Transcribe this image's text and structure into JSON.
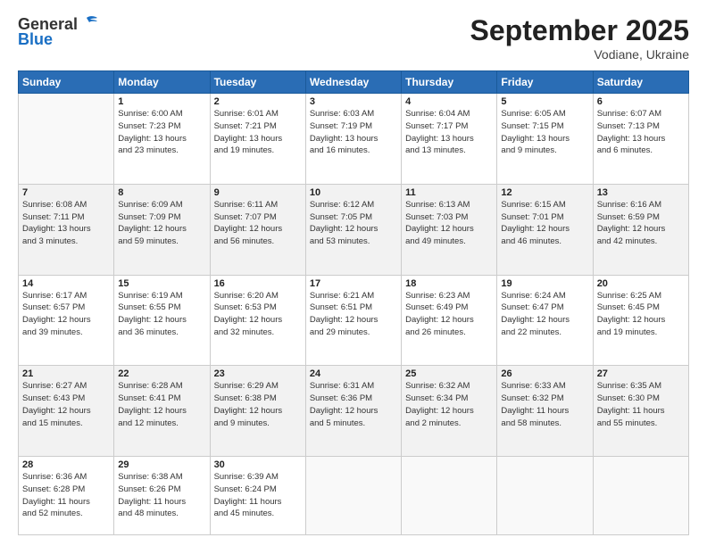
{
  "header": {
    "logo_line1": "General",
    "logo_line2": "Blue",
    "month": "September 2025",
    "location": "Vodiane, Ukraine"
  },
  "days_of_week": [
    "Sunday",
    "Monday",
    "Tuesday",
    "Wednesday",
    "Thursday",
    "Friday",
    "Saturday"
  ],
  "weeks": [
    [
      {
        "day": "",
        "info": ""
      },
      {
        "day": "1",
        "info": "Sunrise: 6:00 AM\nSunset: 7:23 PM\nDaylight: 13 hours\nand 23 minutes."
      },
      {
        "day": "2",
        "info": "Sunrise: 6:01 AM\nSunset: 7:21 PM\nDaylight: 13 hours\nand 19 minutes."
      },
      {
        "day": "3",
        "info": "Sunrise: 6:03 AM\nSunset: 7:19 PM\nDaylight: 13 hours\nand 16 minutes."
      },
      {
        "day": "4",
        "info": "Sunrise: 6:04 AM\nSunset: 7:17 PM\nDaylight: 13 hours\nand 13 minutes."
      },
      {
        "day": "5",
        "info": "Sunrise: 6:05 AM\nSunset: 7:15 PM\nDaylight: 13 hours\nand 9 minutes."
      },
      {
        "day": "6",
        "info": "Sunrise: 6:07 AM\nSunset: 7:13 PM\nDaylight: 13 hours\nand 6 minutes."
      }
    ],
    [
      {
        "day": "7",
        "info": "Sunrise: 6:08 AM\nSunset: 7:11 PM\nDaylight: 13 hours\nand 3 minutes."
      },
      {
        "day": "8",
        "info": "Sunrise: 6:09 AM\nSunset: 7:09 PM\nDaylight: 12 hours\nand 59 minutes."
      },
      {
        "day": "9",
        "info": "Sunrise: 6:11 AM\nSunset: 7:07 PM\nDaylight: 12 hours\nand 56 minutes."
      },
      {
        "day": "10",
        "info": "Sunrise: 6:12 AM\nSunset: 7:05 PM\nDaylight: 12 hours\nand 53 minutes."
      },
      {
        "day": "11",
        "info": "Sunrise: 6:13 AM\nSunset: 7:03 PM\nDaylight: 12 hours\nand 49 minutes."
      },
      {
        "day": "12",
        "info": "Sunrise: 6:15 AM\nSunset: 7:01 PM\nDaylight: 12 hours\nand 46 minutes."
      },
      {
        "day": "13",
        "info": "Sunrise: 6:16 AM\nSunset: 6:59 PM\nDaylight: 12 hours\nand 42 minutes."
      }
    ],
    [
      {
        "day": "14",
        "info": "Sunrise: 6:17 AM\nSunset: 6:57 PM\nDaylight: 12 hours\nand 39 minutes."
      },
      {
        "day": "15",
        "info": "Sunrise: 6:19 AM\nSunset: 6:55 PM\nDaylight: 12 hours\nand 36 minutes."
      },
      {
        "day": "16",
        "info": "Sunrise: 6:20 AM\nSunset: 6:53 PM\nDaylight: 12 hours\nand 32 minutes."
      },
      {
        "day": "17",
        "info": "Sunrise: 6:21 AM\nSunset: 6:51 PM\nDaylight: 12 hours\nand 29 minutes."
      },
      {
        "day": "18",
        "info": "Sunrise: 6:23 AM\nSunset: 6:49 PM\nDaylight: 12 hours\nand 26 minutes."
      },
      {
        "day": "19",
        "info": "Sunrise: 6:24 AM\nSunset: 6:47 PM\nDaylight: 12 hours\nand 22 minutes."
      },
      {
        "day": "20",
        "info": "Sunrise: 6:25 AM\nSunset: 6:45 PM\nDaylight: 12 hours\nand 19 minutes."
      }
    ],
    [
      {
        "day": "21",
        "info": "Sunrise: 6:27 AM\nSunset: 6:43 PM\nDaylight: 12 hours\nand 15 minutes."
      },
      {
        "day": "22",
        "info": "Sunrise: 6:28 AM\nSunset: 6:41 PM\nDaylight: 12 hours\nand 12 minutes."
      },
      {
        "day": "23",
        "info": "Sunrise: 6:29 AM\nSunset: 6:38 PM\nDaylight: 12 hours\nand 9 minutes."
      },
      {
        "day": "24",
        "info": "Sunrise: 6:31 AM\nSunset: 6:36 PM\nDaylight: 12 hours\nand 5 minutes."
      },
      {
        "day": "25",
        "info": "Sunrise: 6:32 AM\nSunset: 6:34 PM\nDaylight: 12 hours\nand 2 minutes."
      },
      {
        "day": "26",
        "info": "Sunrise: 6:33 AM\nSunset: 6:32 PM\nDaylight: 11 hours\nand 58 minutes."
      },
      {
        "day": "27",
        "info": "Sunrise: 6:35 AM\nSunset: 6:30 PM\nDaylight: 11 hours\nand 55 minutes."
      }
    ],
    [
      {
        "day": "28",
        "info": "Sunrise: 6:36 AM\nSunset: 6:28 PM\nDaylight: 11 hours\nand 52 minutes."
      },
      {
        "day": "29",
        "info": "Sunrise: 6:38 AM\nSunset: 6:26 PM\nDaylight: 11 hours\nand 48 minutes."
      },
      {
        "day": "30",
        "info": "Sunrise: 6:39 AM\nSunset: 6:24 PM\nDaylight: 11 hours\nand 45 minutes."
      },
      {
        "day": "",
        "info": ""
      },
      {
        "day": "",
        "info": ""
      },
      {
        "day": "",
        "info": ""
      },
      {
        "day": "",
        "info": ""
      }
    ]
  ]
}
